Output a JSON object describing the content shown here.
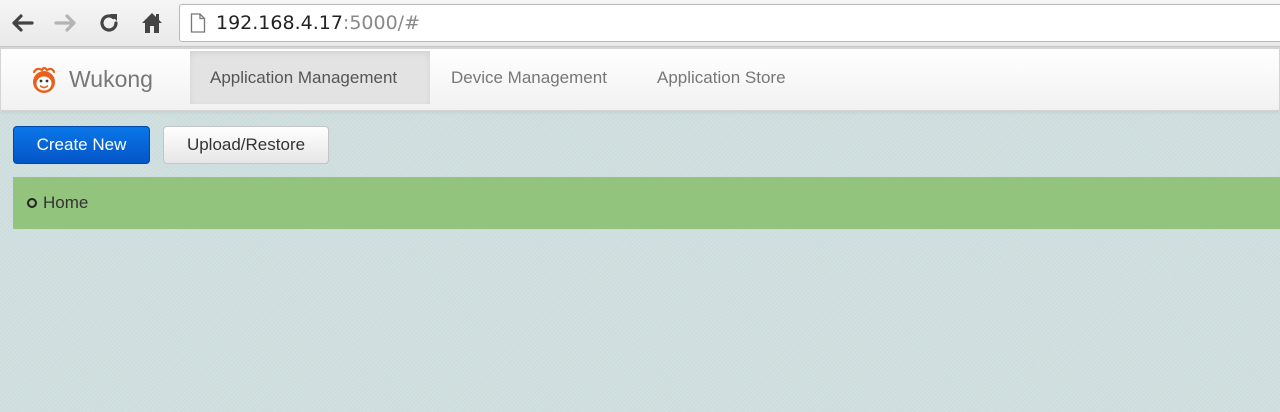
{
  "browser": {
    "url_host": "192.168.4.17",
    "url_rest": ":5000/#",
    "icons": {
      "back": "back-arrow-icon",
      "forward": "forward-arrow-icon",
      "reload": "reload-icon",
      "home": "home-icon",
      "page": "page-icon"
    }
  },
  "navbar": {
    "brand": "Wukong",
    "items": [
      {
        "label": "Application Management",
        "active": true
      },
      {
        "label": "Device Management",
        "active": false
      },
      {
        "label": "Application Store",
        "active": false
      }
    ]
  },
  "toolbar": {
    "create_label": "Create New",
    "upload_label": "Upload/Restore"
  },
  "breadcrumb": {
    "label": "Home"
  },
  "colors": {
    "page_bg": "#d0dfdf",
    "crumb_bg": "#92c47d",
    "primary": "#0a77e8",
    "logo_orange": "#e8611c"
  }
}
